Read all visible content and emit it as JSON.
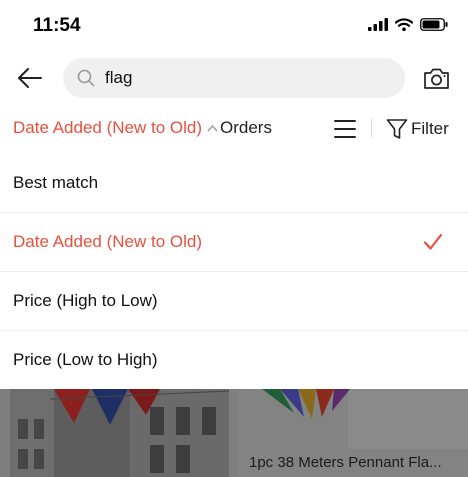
{
  "status": {
    "time": "11:54"
  },
  "search": {
    "query": "flag"
  },
  "sort_bar": {
    "active": "Date Added (New to Old)",
    "orders": "Orders",
    "filter": "Filter"
  },
  "sort_options": [
    {
      "label": "Best match",
      "selected": false
    },
    {
      "label": "Date Added (New to Old)",
      "selected": true
    },
    {
      "label": "Price (High to Low)",
      "selected": false
    },
    {
      "label": "Price (Low to High)",
      "selected": false
    }
  ],
  "products": [
    {
      "title": ""
    },
    {
      "title": "1pc 38 Meters Pennant Fla..."
    }
  ],
  "colors": {
    "accent": "#e8503e",
    "overlay": "#7f7f7f"
  },
  "icons": [
    "signal-icon",
    "wifi-icon",
    "battery-icon",
    "back-arrow-icon",
    "search-icon",
    "camera-icon",
    "chevron-up-icon",
    "list-view-icon",
    "filter-icon",
    "checkmark-icon"
  ]
}
